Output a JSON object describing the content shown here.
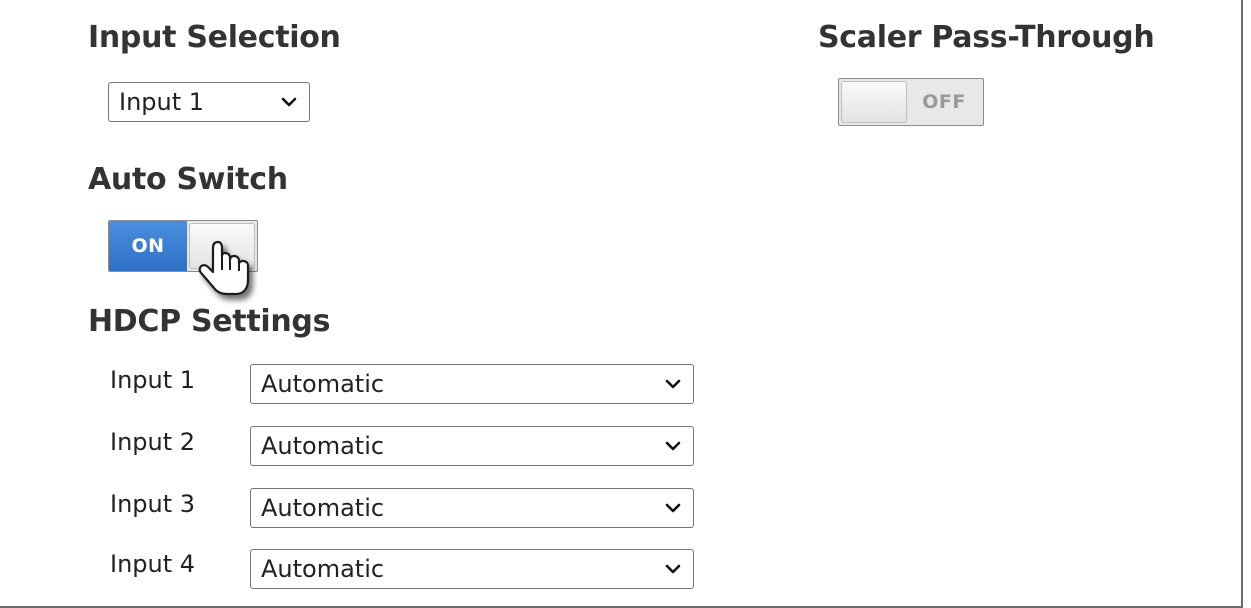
{
  "input_selection": {
    "heading": "Input Selection",
    "selected": "Input 1"
  },
  "scaler_pass_through": {
    "heading": "Scaler Pass-Through",
    "state_label": "OFF"
  },
  "auto_switch": {
    "heading": "Auto Switch",
    "state_label": "ON"
  },
  "hdcp": {
    "heading": "HDCP Settings",
    "rows": [
      {
        "label": "Input 1",
        "value": "Automatic"
      },
      {
        "label": "Input 2",
        "value": "Automatic"
      },
      {
        "label": "Input 3",
        "value": "Automatic"
      },
      {
        "label": "Input 4",
        "value": "Automatic"
      }
    ]
  },
  "colors": {
    "toggle_on": "#3a7fd5",
    "toggle_off_text": "#999999"
  },
  "icons": {
    "dropdown": "chevron-down-icon",
    "cursor": "hand-pointer-icon"
  }
}
